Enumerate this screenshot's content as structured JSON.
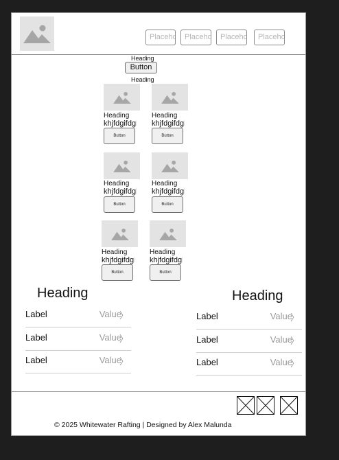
{
  "header": {
    "logo_icon": "image-placeholder-icon",
    "nav_fields": [
      {
        "placeholder": "Placeholder"
      },
      {
        "placeholder": "Placeholder"
      },
      {
        "placeholder": "Placeholder"
      },
      {
        "placeholder": "Placeholder"
      }
    ]
  },
  "hero": {
    "heading_top": "Heading",
    "button_label": "Button",
    "heading_bottom": "Heading"
  },
  "cards": [
    {
      "heading": "Heading",
      "text": "khjfdgifdgh",
      "button": "Button"
    },
    {
      "heading": "Heading",
      "text": "khjfdgifdgh",
      "button": "Button"
    },
    {
      "heading": "Heading",
      "text": "khjfdgifdgh",
      "button": "Button"
    },
    {
      "heading": "Heading",
      "text": "khjfdgifdgh",
      "button": "Button"
    },
    {
      "heading": "Heading",
      "text": "khjfdgifdgh",
      "button": "Button"
    },
    {
      "heading": "Heading",
      "text": "khjfdgifdgh",
      "button": "Button"
    }
  ],
  "lists": [
    {
      "heading": "Heading",
      "rows": [
        {
          "label": "Label",
          "value": "Value"
        },
        {
          "label": "Label",
          "value": "Value"
        },
        {
          "label": "Label",
          "value": "Value"
        }
      ]
    },
    {
      "heading": "Heading",
      "rows": [
        {
          "label": "Label",
          "value": "Value"
        },
        {
          "label": "Label",
          "value": "Value"
        },
        {
          "label": "Label",
          "value": "Value"
        }
      ]
    }
  ],
  "footer": {
    "social_icons": [
      "x-placeholder-icon",
      "x-placeholder-icon",
      "x-placeholder-icon"
    ],
    "copyright": "© 2025 Whitewater Rafting | Designed by Alex Malunda"
  }
}
